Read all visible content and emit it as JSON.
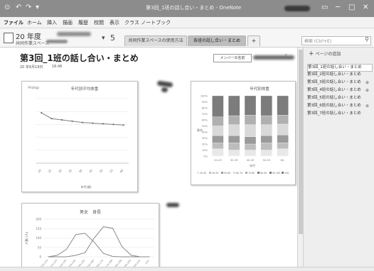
{
  "titlebar": {
    "quick_access": [
      "⊙",
      "↶",
      "↷",
      "▾"
    ],
    "title": "第3回_1班の話し合い・まとめ - OneNote",
    "window_buttons": [
      "▭",
      "─",
      "□",
      "✕"
    ]
  },
  "ribbon": {
    "tabs": [
      "ファイル",
      "ホーム",
      "挿入",
      "描画",
      "履歴",
      "校閲",
      "表示",
      "クラス ノートブック"
    ]
  },
  "notebook": {
    "name": "20 年度",
    "sub": "共同作業スペース",
    "chevron": "▾",
    "count": "5",
    "sections": [
      "共同作業スペースの使用方法",
      "各班の話し合い・まとめ"
    ],
    "add_section": "+",
    "search_placeholder": "検索 (Ctrl+E)",
    "search_icon": "⚲"
  },
  "page": {
    "title": "第3回_1班の話し合い・まとめ",
    "date": "20 年6月18日",
    "time": "16:46",
    "member_label": "メンバーの名前",
    "expand_icon": "⤢"
  },
  "colors": {
    "titlebar": "#8c8c8c",
    "selected_section": "#bdbdbd",
    "chart_line": "#7f7f7f"
  },
  "chart_data": [
    {
      "type": "line",
      "title": "年代別平均体重",
      "ylabel": "平均(kg)",
      "xlabel": "年代(歳)",
      "categories": [
        "20",
        "25",
        "30",
        "35",
        "40",
        "45",
        "50",
        "55",
        "60"
      ],
      "values": [
        78,
        69,
        67,
        65,
        63,
        62,
        61,
        60,
        59
      ],
      "ylim": [
        0,
        100
      ],
      "grid": true
    },
    {
      "type": "bar",
      "stacked": "percent",
      "title": "年代別体重",
      "xlabel": "年代",
      "ylabel": "割合",
      "categories": [
        "20-29",
        "30-39",
        "40-49",
        "50-59",
        "60-"
      ],
      "yticks": [
        "0%",
        "10%",
        "20%",
        "30%",
        "40%",
        "50%",
        "60%",
        "70%",
        "80%",
        "90%",
        "100%"
      ],
      "series": [
        {
          "name": "20-40",
          "color": "#e8e8e8",
          "values": [
            0.12,
            0.1,
            0.1,
            0.1,
            0.12
          ]
        },
        {
          "name": "40-50",
          "color": "#bdbdbd",
          "values": [
            0.1,
            0.12,
            0.1,
            0.12,
            0.1
          ]
        },
        {
          "name": "50-60",
          "color": "#9a9a9a",
          "values": [
            0.12,
            0.12,
            0.12,
            0.12,
            0.13
          ]
        },
        {
          "name": "60-70",
          "color": "#d9d9d9",
          "values": [
            0.16,
            0.18,
            0.2,
            0.18,
            0.18
          ]
        },
        {
          "name": "70-80",
          "color": "#b0b0b0",
          "values": [
            0.15,
            0.15,
            0.16,
            0.15,
            0.15
          ]
        },
        {
          "name": "80-90",
          "color": "#7c7c7c",
          "values": [
            0.35,
            0.33,
            0.32,
            0.33,
            0.32
          ]
        }
      ],
      "legend_labels": [
        "20-40",
        "40-50",
        "50-60",
        "60-70",
        "70-80",
        "80-90",
        "90-100",
        "100-"
      ],
      "legend": "bottom"
    },
    {
      "type": "line",
      "title": "男女　身長",
      "ylabel": "人数 (人)",
      "y_ticks": [
        0,
        50,
        100,
        150,
        200
      ],
      "ylim": [
        0,
        200
      ],
      "categories": [
        "100-110",
        "110-120",
        "120-130",
        "130-140",
        "140-150",
        "150-160",
        "160-170",
        "170-180",
        "180-190",
        "190-200",
        "200-210",
        "210-"
      ],
      "series": [
        {
          "name": "女",
          "values": [
            0,
            8,
            40,
            118,
            125,
            78,
            18,
            2,
            0,
            0,
            0,
            0
          ]
        },
        {
          "name": "男",
          "values": [
            0,
            0,
            0,
            8,
            22,
            100,
            160,
            152,
            55,
            8,
            0,
            0
          ]
        }
      ],
      "grid": true
    }
  ],
  "pages_panel": {
    "add_label": "ページの追加",
    "add_icon": "+",
    "items": [
      {
        "label": "第3回_1班の話し合い・まとめ",
        "selected": true,
        "flag": ""
      },
      {
        "label": "第3回_2班の話し合い・まとめ",
        "selected": false,
        "flag": ""
      },
      {
        "label": "第3回_3班の話し合い・まとめ",
        "selected": false,
        "flag": "⊕"
      },
      {
        "label": "第3回_4班の話し合い・まとめ",
        "selected": false,
        "flag": "⊕"
      },
      {
        "label": "第3回_5班の話し合い・まとめ",
        "selected": false,
        "flag": ""
      },
      {
        "label": "第3回_6班の話し合い・まとめ",
        "selected": false,
        "flag": "⊕"
      },
      {
        "label": "第3回_7班の話し合い・まとめ",
        "selected": false,
        "flag": ""
      }
    ]
  }
}
